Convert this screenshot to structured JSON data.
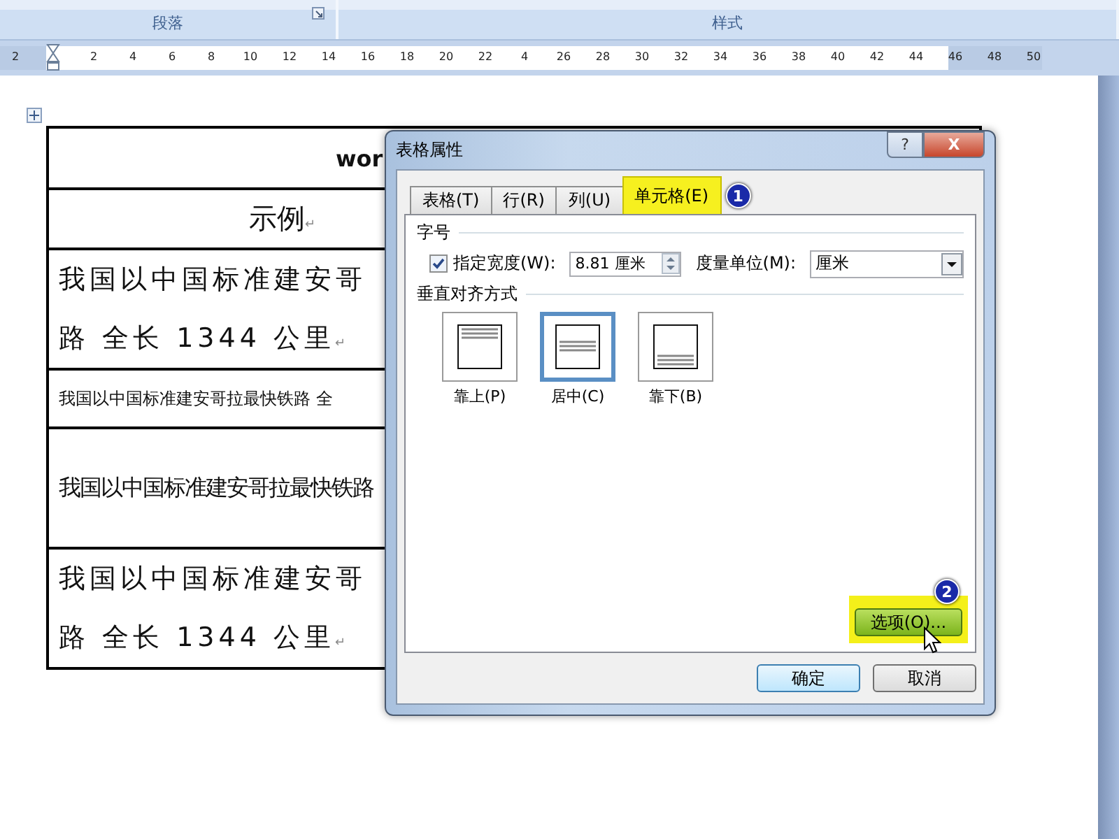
{
  "ribbon": {
    "groups": [
      {
        "label": "段落",
        "launcher": true
      },
      {
        "label": "样式"
      }
    ]
  },
  "ruler": {
    "labels": [
      "2",
      "2",
      "4",
      "6",
      "8",
      "10",
      "12",
      "14",
      "16",
      "18",
      "20",
      "22",
      "4",
      "26",
      "28",
      "30",
      "32",
      "34",
      "36",
      "38",
      "40",
      "42",
      "44",
      "46",
      "48",
      "50"
    ]
  },
  "table": {
    "rows": [
      {
        "kind": "title",
        "lines": [
          "wor"
        ]
      },
      {
        "kind": "heading",
        "lines": [
          "示例"
        ],
        "end_mark": "↵"
      },
      {
        "kind": "large",
        "lines": [
          "我国以中国标准建安哥",
          "路 全长 1344 公里"
        ],
        "end_mark": "↵"
      },
      {
        "kind": "small",
        "lines": [
          "我国以中国标准建安哥拉最快铁路 全"
        ]
      },
      {
        "kind": "condensed",
        "lines": [
          "我国以中国标准建安哥拉最快铁路"
        ]
      },
      {
        "kind": "large",
        "lines": [
          "我国以中国标准建安哥",
          "路 全长 1344 公里"
        ],
        "end_mark": "↵"
      }
    ]
  },
  "dialog": {
    "title": "表格属性",
    "help": "?",
    "close": "X",
    "tabs": [
      {
        "label": "表格(T)",
        "selected": false
      },
      {
        "label": "行(R)",
        "selected": false
      },
      {
        "label": "列(U)",
        "selected": false
      },
      {
        "label": "单元格(E)",
        "selected": true,
        "step": "1"
      }
    ],
    "size_group": {
      "label": "字号",
      "width_checkbox": {
        "label": "指定宽度(W):",
        "checked": true
      },
      "width_value": "8.81 厘米",
      "unit_label": "度量单位(M):",
      "unit_value": "厘米"
    },
    "align_group": {
      "label": "垂直对齐方式",
      "options": [
        {
          "kind": "top",
          "label": "靠上(P)",
          "selected": false
        },
        {
          "kind": "center",
          "label": "居中(C)",
          "selected": true
        },
        {
          "kind": "bottom",
          "label": "靠下(B)",
          "selected": false
        }
      ]
    },
    "options_button": {
      "label": "选项(O)...",
      "step": "2"
    },
    "buttons": [
      "确定",
      "取消"
    ]
  }
}
